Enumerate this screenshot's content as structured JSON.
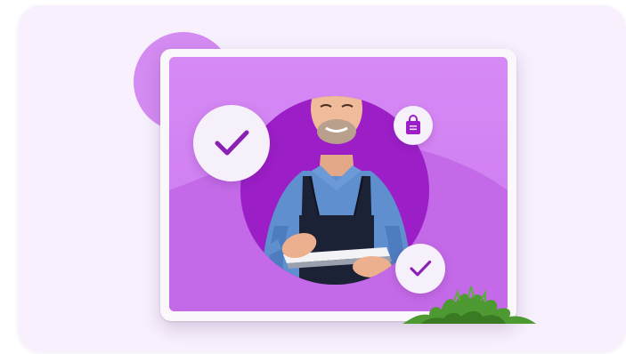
{
  "illustration": {
    "subject": "shopkeeper-using-tablet",
    "icons": [
      "check-icon",
      "shopping-bag-icon",
      "check-icon"
    ],
    "colors": {
      "card_background": "#f8f1fd",
      "screen_purple": "#cf7cf1",
      "dark_purple": "#9d1fc6",
      "badge_background": "#f6f0fa",
      "check_stroke": "#8a21b2",
      "grass_green": "#3f8a2a"
    }
  }
}
